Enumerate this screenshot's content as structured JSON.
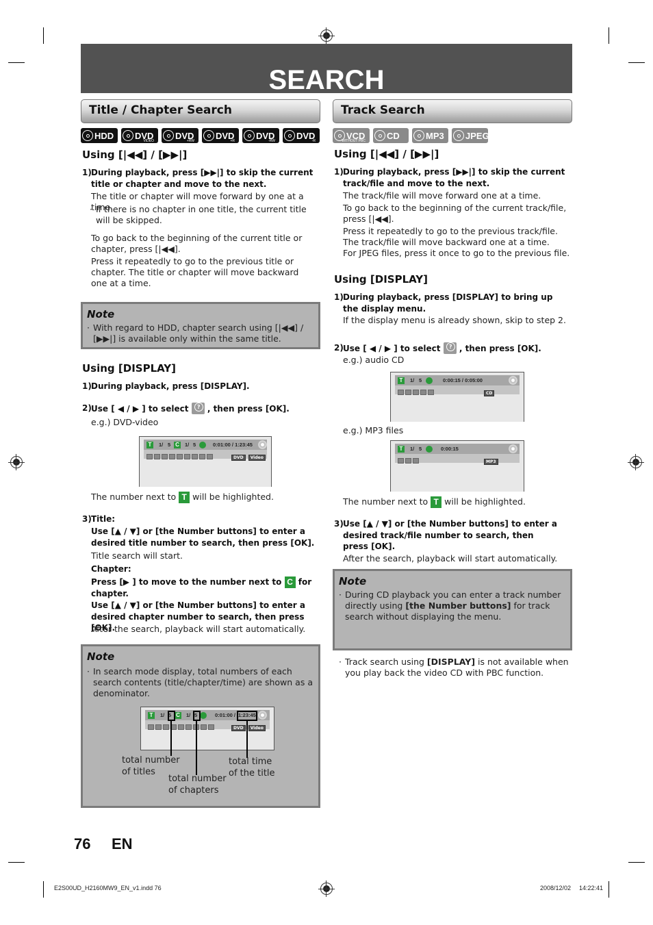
{
  "header": {
    "title": "SEARCH"
  },
  "left": {
    "section_title": "Title / Chapter Search",
    "badges": [
      {
        "icon": "hdd-icon",
        "label": "HDD",
        "sub": ""
      },
      {
        "icon": "disc-icon",
        "label": "DVD",
        "sub": "VIDEO"
      },
      {
        "icon": "disc-icon",
        "label": "DVD",
        "sub": "+RW"
      },
      {
        "icon": "disc-icon",
        "label": "DVD",
        "sub": "+R"
      },
      {
        "icon": "disc-icon",
        "label": "DVD",
        "sub": "-RW"
      },
      {
        "icon": "disc-icon",
        "label": "DVD",
        "sub": "-R"
      }
    ],
    "using_skip": {
      "heading": "Using [|◀◀] / [▶▶|]",
      "step1_num": "1)",
      "step1": "During playback, press [▶▶|] to skip the current title or chapter and move to the next.",
      "step1_text": "The title or chapter will move forward by one at a time.",
      "step1_bullet": "If there is no chapter in one title, the current title will be skipped.",
      "back_text": "To go back to the beginning of the current title or chapter, press [|◀◀].",
      "repeat_text": "Press it repeatedly to go to the previous title or chapter. The title or chapter will move backward one at a time."
    },
    "note1": {
      "title": "Note",
      "bullet": "With regard to HDD, chapter search using [|◀◀] / [▶▶|] is available only within the same title."
    },
    "using_display": {
      "heading": "Using [DISPLAY]",
      "step1_num": "1)",
      "step1": "During playback, press [DISPLAY].",
      "step2_num": "2)",
      "step2_a": "Use [ ◀ / ▶ ] to select",
      "step2_b": ", then press [OK].",
      "example": "e.g.) DVD-video",
      "osd": {
        "t_icon": "T",
        "title_num": "1/",
        "title_total": "5",
        "c_icon": "C",
        "chap_num": "1/",
        "chap_total": "5",
        "time": "0:01:00 / 1:23:45",
        "tag1": "DVD",
        "tag2": "Video"
      },
      "highlight_a": "The number next to",
      "highlight_b": "will be highlighted.",
      "t_icon": "T",
      "step3_num": "3)",
      "step3_title": "Title:",
      "step3_title_bold": "Use [▲ / ▼] or [the Number buttons] to enter a desired title number to search, then press [OK].",
      "step3_title_text": "Title search will start.",
      "step3_chapter": "Chapter:",
      "step3_chapter_bold_a": "Press [▶ ] to move to the number next to",
      "step3_chapter_bold_b": "for chapter.",
      "c_icon": "C",
      "step3_chapter_bold2": "Use [▲ / ▼] or [the Number buttons] to enter a desired chapter number to search, then press [OK].",
      "step3_after": "After the search, playback will start automatically."
    },
    "note2": {
      "title": "Note",
      "bullet": "In search mode display, total numbers of each search contents (title/chapter/time) are shown as a denominator.",
      "osd": {
        "t_icon": "T",
        "title_num": "1/",
        "title_total": "5",
        "c_icon": "C",
        "chap_num": "1/",
        "chap_total": "5",
        "time_a": "0:01:00 /",
        "time_b": "1:23:45",
        "tag1": "DVD",
        "tag2": "Video"
      },
      "label_titles": "total number of titles",
      "label_chapters": "total number of chapters",
      "label_time": "total time of the title"
    }
  },
  "right": {
    "section_title": "Track Search",
    "badges": [
      {
        "label": "VCD",
        "sub": "WITHOUT PBC"
      },
      {
        "label": "CD",
        "sub": ""
      },
      {
        "label": "MP3",
        "sub": ""
      },
      {
        "label": "JPEG",
        "sub": ""
      }
    ],
    "using_skip": {
      "heading": "Using [|◀◀] / [▶▶|]",
      "step1_num": "1)",
      "step1": "During playback, press [▶▶|] to skip the current track/file and move to the next.",
      "line1": "The track/file will move forward one at a time.",
      "line2": "To go back to the beginning of the current track/file, press [|◀◀].",
      "line3": "Press it repeatedly to go to the previous track/file. The track/file will move backward one at a time.",
      "line4": "For JPEG files, press it once to go to the previous file."
    },
    "using_display": {
      "heading": "Using [DISPLAY]",
      "step1_num": "1)",
      "step1": "During playback, press [DISPLAY] to bring up the display menu.",
      "step1_text": "If the display menu is already shown, skip to step 2.",
      "step2_num": "2)",
      "step2_a": "Use [ ◀ / ▶ ] to select",
      "step2_b": ", then press [OK].",
      "example_cd": "e.g.) audio CD",
      "osd_cd": {
        "t_icon": "T",
        "track_num": "1/",
        "track_total": "5",
        "time": "0:00:15 / 0:05:00",
        "tag": "CD"
      },
      "example_mp3": "e.g.) MP3 files",
      "osd_mp3": {
        "t_icon": "T",
        "track_num": "1/",
        "track_total": "5",
        "time": "0:00:15",
        "tag": "MP3"
      },
      "highlight_a": "The number next to",
      "highlight_b": "will be highlighted.",
      "t_icon": "T",
      "step3_num": "3)",
      "step3": "Use [▲ / ▼] or [the Number buttons] to enter a desired track/file number to search, then press [OK].",
      "step3_text": "After the search, playback will start automatically."
    },
    "note": {
      "title": "Note",
      "bullet1_a": "During CD playback you can enter a track number directly using ",
      "bullet1_b": "[the Number buttons]",
      "bullet1_c": " for track search without displaying the menu.",
      "bullet2_a": "Track search using ",
      "bullet2_b": "[DISPLAY]",
      "bullet2_c": " is not available when you play back the video CD with PBC function."
    }
  },
  "footer": {
    "page_number": "76",
    "lang": "EN",
    "file": "E2S00UD_H2160MW9_EN_v1.indd   76",
    "date": "2008/12/02",
    "time": "14:22:41"
  }
}
